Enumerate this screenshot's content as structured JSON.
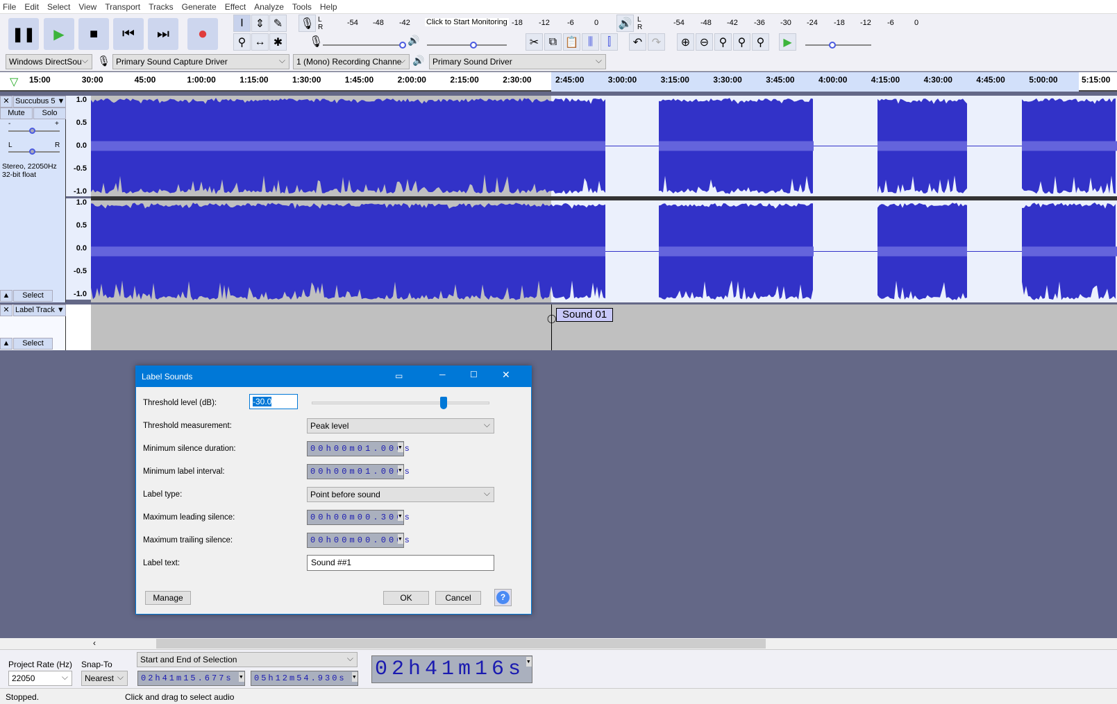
{
  "menu": [
    "File",
    "Edit",
    "Select",
    "View",
    "Transport",
    "Tracks",
    "Generate",
    "Effect",
    "Analyze",
    "Tools",
    "Help"
  ],
  "transport": {
    "pause": "pause-icon",
    "play": "play-icon",
    "stop": "stop-icon",
    "skip_start": "skip-start-icon",
    "skip_end": "skip-end-icon",
    "record": "record-icon",
    "record_color": "#e03c3c",
    "play_color": "#3cb43c"
  },
  "record_meter": {
    "ticks": [
      "-54",
      "-48",
      "-42",
      "-18",
      "-12",
      "-6",
      "0"
    ],
    "monitor_text": "Click to Start Monitoring",
    "l": "L",
    "r": "R"
  },
  "play_meter": {
    "ticks": [
      "-54",
      "-48",
      "-42",
      "-36",
      "-30",
      "-24",
      "-18",
      "-12",
      "-6",
      "0"
    ],
    "l": "L",
    "r": "R"
  },
  "devices": {
    "host": "Windows DirectSou",
    "recording_device": "Primary Sound Capture Driver",
    "channels": "1 (Mono) Recording Channe",
    "playback_device": "Primary Sound Driver"
  },
  "ruler": {
    "ticks": [
      "15:00",
      "30:00",
      "45:00",
      "1:00:00",
      "1:15:00",
      "1:30:00",
      "1:45:00",
      "2:00:00",
      "2:15:00",
      "2:30:00",
      "2:45:00",
      "3:00:00",
      "3:15:00",
      "3:30:00",
      "3:45:00",
      "4:00:00",
      "4:15:00",
      "4:30:00",
      "4:45:00",
      "5:00:00",
      "5:15:00"
    ]
  },
  "audio_track": {
    "name": "Succubus 5",
    "mute": "Mute",
    "solo": "Solo",
    "info_line1": "Stereo, 22050Hz",
    "info_line2": "32-bit float",
    "select": "Select",
    "gain_minus": "-",
    "gain_plus": "+",
    "pan_l": "L",
    "pan_r": "R",
    "scale": [
      "1.0",
      "0.5",
      "0.0",
      "-0.5",
      "-1.0"
    ],
    "wave_color": "#3232c8",
    "rms_color": "#6464dc"
  },
  "label_track": {
    "name": "Label Track",
    "select": "Select",
    "label": "Sound 01"
  },
  "dialog": {
    "title": "Label Sounds",
    "threshold_label": "Threshold level (dB):",
    "threshold_value": "-30.0",
    "threshold_slider_fraction": 0.74,
    "measurement_label": "Threshold measurement:",
    "measurement_value": "Peak level",
    "min_silence_label": "Minimum silence duration:",
    "min_silence_value": "00h00m01.000s",
    "min_interval_label": "Minimum label interval:",
    "min_interval_value": "00h00m01.000s",
    "label_type_label": "Label type:",
    "label_type_value": "Point before sound",
    "max_leading_label": "Maximum leading silence:",
    "max_leading_value": "00h00m00.300s",
    "max_trailing_label": "Maximum trailing silence:",
    "max_trailing_value": "00h00m00.000s",
    "label_text_label": "Label text:",
    "label_text_value": "Sound ##1",
    "manage": "Manage",
    "ok": "OK",
    "cancel": "Cancel",
    "help": "?"
  },
  "selection_bar": {
    "project_rate_label": "Project Rate (Hz)",
    "project_rate": "22050",
    "snap_label": "Snap-To",
    "snap": "Nearest",
    "mode": "Start and End of Selection",
    "start": "02h41m15.677s",
    "end": "05h12m54.930s",
    "audio_position": "02h41m16s"
  },
  "status": {
    "state": "Stopped.",
    "hint": "Click and drag to select audio"
  }
}
